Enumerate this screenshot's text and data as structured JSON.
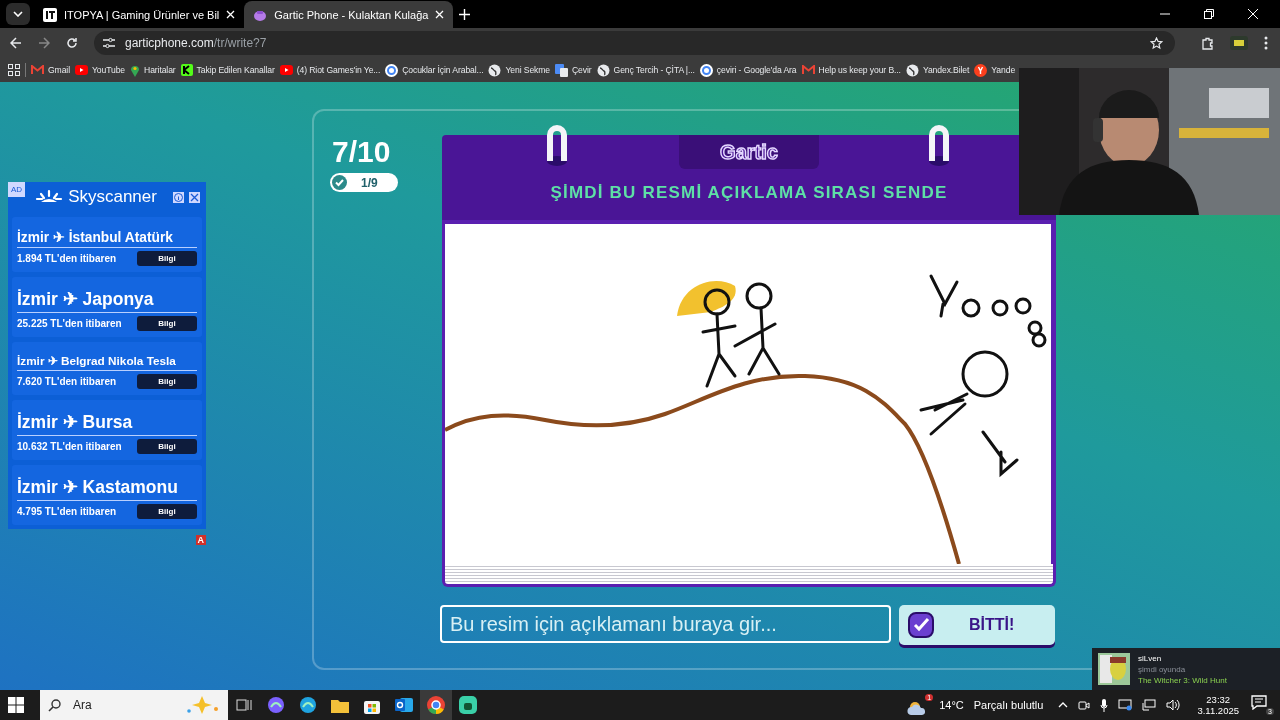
{
  "browser": {
    "tabs": [
      {
        "title": "ITOPYA | Gaming Ürünler ve Bil",
        "kind": "site",
        "selected": false
      },
      {
        "title": "Gartic Phone - Kulaktan Kulağa",
        "kind": "phone",
        "selected": true
      }
    ],
    "url_host": "garticphone.com",
    "url_path": "/tr/write?7",
    "bookmarks": [
      {
        "label": "Gmail",
        "kind": "gmail"
      },
      {
        "label": "YouTube",
        "kind": "youtube"
      },
      {
        "label": "Haritalar",
        "kind": "maps"
      },
      {
        "label": "Takip Edilen Kanallar",
        "kind": "kick"
      },
      {
        "label": "(4) Riot Games'in Ye...",
        "kind": "youtube"
      },
      {
        "label": "Çocuklar İçin Arabal...",
        "kind": "google"
      },
      {
        "label": "Yeni Sekme",
        "kind": "globe"
      },
      {
        "label": "Çevir",
        "kind": "translate"
      },
      {
        "label": "Genç Tercih - ÇİTA |...",
        "kind": "globe"
      },
      {
        "label": "çeviri - Google'da Ara",
        "kind": "google"
      },
      {
        "label": "Help us keep your B...",
        "kind": "gmail"
      },
      {
        "label": "Yandex.Bilet",
        "kind": "globe"
      },
      {
        "label": "Yande",
        "kind": "yandex"
      }
    ]
  },
  "ad": {
    "label": "AD",
    "brand": "Skyscanner",
    "badge": "A",
    "items": [
      {
        "route": "İzmir ✈ İstanbul Atatürk",
        "price": "1.894 TL'den itibaren",
        "button": "Bilgi"
      },
      {
        "route": "İzmir ✈ Japonya",
        "price": "25.225 TL'den itibaren",
        "button": "Bilgi"
      },
      {
        "route": "İzmir ✈ Belgrad Nikola Tesla",
        "price": "7.620 TL'den itibaren",
        "button": "Bilgi"
      },
      {
        "route": "İzmir ✈ Bursa",
        "price": "10.632 TL'den itibaren",
        "button": "Bilgi"
      },
      {
        "route": "İzmir ✈ Kastamonu",
        "price": "4.795 TL'den itibaren",
        "button": "Bilgi"
      }
    ]
  },
  "game": {
    "round": "7/10",
    "done": "1/9",
    "logo": "Gartic",
    "prompt": "ŞİMDİ BU RESMİ AÇIKLAMA SIRASI SENDE",
    "placeholder": "Bu resim için açıklamanı buraya gir...",
    "button": "BİTTİ!"
  },
  "toast": {
    "name": "siLven",
    "status": "şimdi oyunda",
    "game": "The Witcher 3: Wild Hunt"
  },
  "taskbar": {
    "search": "Ara",
    "apps": [
      {
        "kind": "taskview",
        "selected": false
      },
      {
        "kind": "copilot",
        "selected": false
      },
      {
        "kind": "edge",
        "selected": false
      },
      {
        "kind": "files",
        "selected": false
      },
      {
        "kind": "store",
        "selected": false
      },
      {
        "kind": "outlook",
        "selected": false
      },
      {
        "kind": "chrome",
        "selected": true
      },
      {
        "kind": "game",
        "selected": false
      }
    ],
    "weather_badge": "1",
    "temperature": "14°C",
    "weather": "Parçalı bulutlu",
    "time": "23:32",
    "date": "3.11.2025",
    "notifications": "3"
  }
}
